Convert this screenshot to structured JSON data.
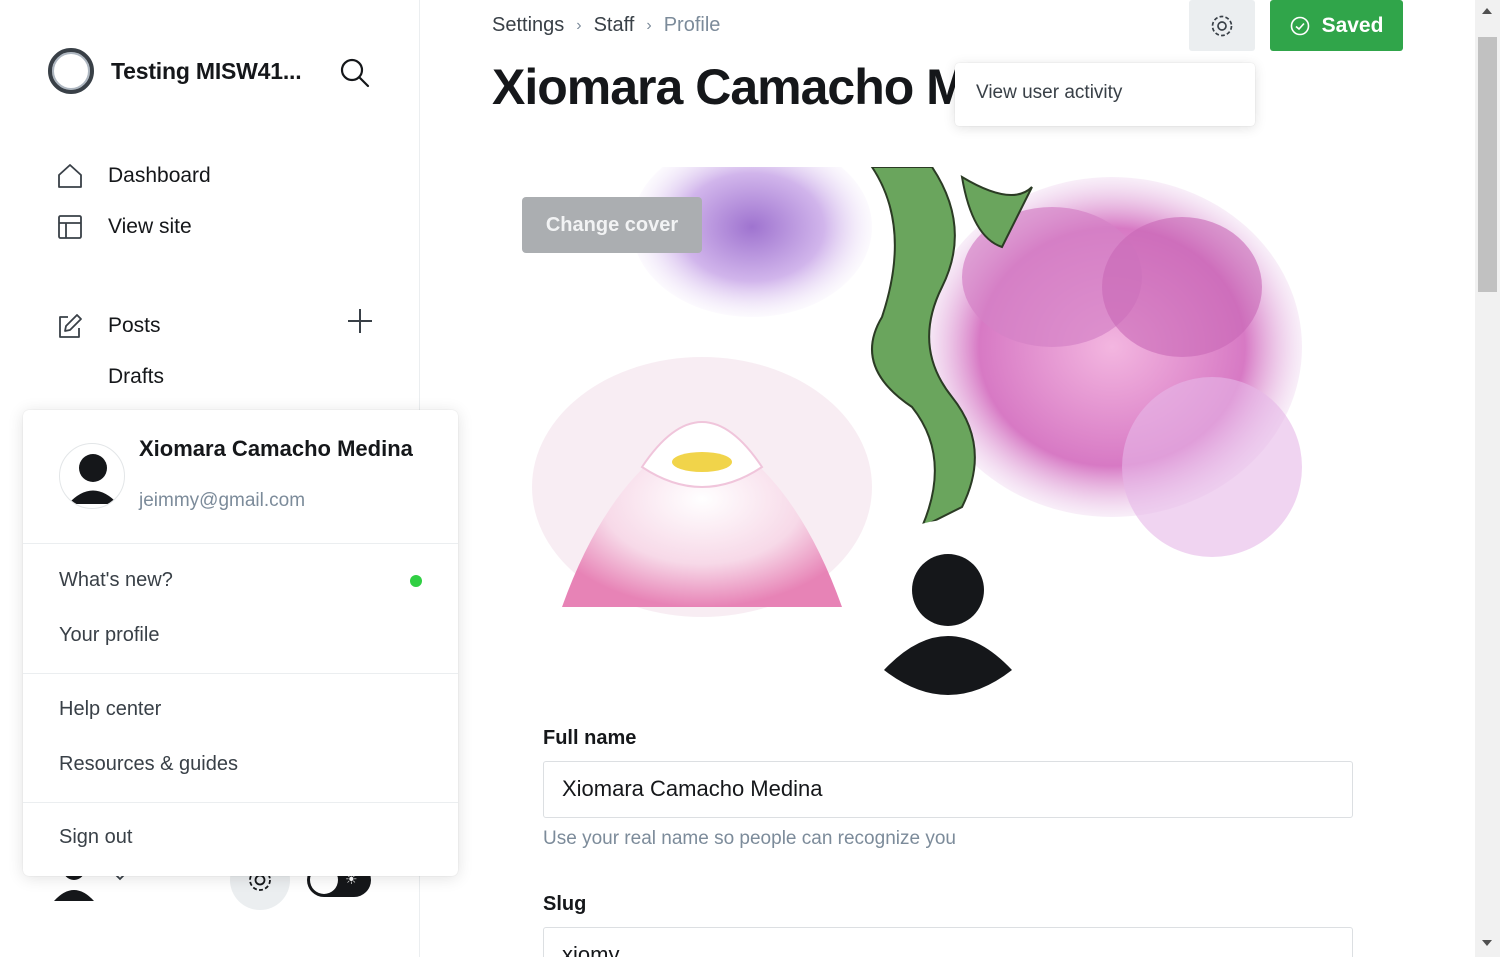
{
  "sidebar": {
    "site_title": "Testing MISW41...",
    "nav": [
      {
        "label": "Dashboard",
        "icon": "home-icon"
      },
      {
        "label": "View site",
        "icon": "layout-icon"
      },
      {
        "label": "Posts",
        "icon": "edit-icon"
      },
      {
        "label": "Drafts"
      }
    ]
  },
  "user_menu": {
    "name": "Xiomara Camacho Medina",
    "email": "jeimmy@gmail.com",
    "items": [
      "What's new?",
      "Your profile",
      "Help center",
      "Resources & guides",
      "Sign out"
    ],
    "whats_new_dot_color": "#30cf43"
  },
  "header": {
    "breadcrumb": [
      "Settings",
      "Staff",
      "Profile"
    ],
    "title": "Xiomara Camacho Medina",
    "saved_label": "Saved",
    "dropdown_item": "View user activity"
  },
  "cover": {
    "change_cover_label": "Change cover"
  },
  "form": {
    "full_name_label": "Full name",
    "full_name_value": "Xiomara Camacho Medina",
    "full_name_hint": "Use your real name so people can recognize you",
    "slug_label": "Slug",
    "slug_value": "xiomy"
  },
  "colors": {
    "accent_green": "#30a54a",
    "text_dark": "#15171a",
    "text_muted": "#7c8b9a"
  }
}
